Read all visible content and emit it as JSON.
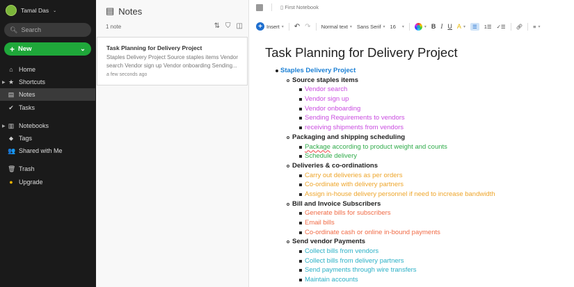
{
  "sidebar": {
    "user": "Tamal Das",
    "search_placeholder": "Search",
    "new_label": "New",
    "items": [
      {
        "label": "Home",
        "icon": "home-icon",
        "glyph": "⌂"
      },
      {
        "label": "Shortcuts",
        "icon": "star-icon",
        "glyph": "★"
      },
      {
        "label": "Notes",
        "icon": "notes-icon",
        "glyph": "▤"
      },
      {
        "label": "Tasks",
        "icon": "tasks-icon",
        "glyph": "✔"
      },
      {
        "label": "Notebooks",
        "icon": "notebook-icon",
        "glyph": "▥"
      },
      {
        "label": "Tags",
        "icon": "tag-icon",
        "glyph": "⬥"
      },
      {
        "label": "Shared with Me",
        "icon": "shared-icon",
        "glyph": "👥"
      },
      {
        "label": "Trash",
        "icon": "trash-icon",
        "glyph": "🗑"
      },
      {
        "label": "Upgrade",
        "icon": "upgrade-icon",
        "glyph": "●"
      }
    ]
  },
  "notelist": {
    "title": "Notes",
    "count": "1 note",
    "note": {
      "title": "Task Planning for Delivery Project",
      "snippet": "Staples Delivery Project Source staples items Vendor search Vendor sign up Vendor onboarding Sending...",
      "time": "a few seconds ago"
    }
  },
  "editor": {
    "notebook": "First Notebook",
    "toolbar": {
      "insert": "Insert",
      "style": "Normal text",
      "font": "Sans Serif",
      "size": "16"
    },
    "title": "Task Planning for Delivery Project",
    "colors": {
      "project": "#1a7fd4",
      "purple": "#c94be0",
      "green": "#2fab4a",
      "orange": "#eea52a",
      "red": "#f06a45",
      "teal": "#2bb0c6"
    },
    "outline": [
      {
        "level": 1,
        "text": "Staples Delivery Project",
        "color": "project"
      },
      {
        "level": 2,
        "text": "Source staples items"
      },
      {
        "level": 3,
        "text": "Vendor search",
        "color": "purple"
      },
      {
        "level": 3,
        "text": "Vendor sign up",
        "color": "purple"
      },
      {
        "level": 3,
        "text": "Vendor onboarding",
        "color": "purple"
      },
      {
        "level": 3,
        "text": "Sending Requirements to vendors",
        "color": "purple"
      },
      {
        "level": 3,
        "text": "receiving shipments from vendors",
        "color": "purple"
      },
      {
        "level": 2,
        "text": "Packaging and shipping scheduling"
      },
      {
        "level": 3,
        "text": "Package according to product weight and counts",
        "color": "green",
        "spell": "Package"
      },
      {
        "level": 3,
        "text": "Schedule delivery",
        "color": "green"
      },
      {
        "level": 2,
        "text": "Deliveries & co-ordinations"
      },
      {
        "level": 3,
        "text": "Carry out deliveries as per orders",
        "color": "orange"
      },
      {
        "level": 3,
        "text": "Co-ordinate with delivery partners",
        "color": "orange"
      },
      {
        "level": 3,
        "text": "Assign in-house delivery personnel if need to increase bandwidth",
        "color": "orange"
      },
      {
        "level": 2,
        "text": "Bill and Invoice Subscribers"
      },
      {
        "level": 3,
        "text": "Generate bills for subscribers",
        "color": "red"
      },
      {
        "level": 3,
        "text": "Email bills",
        "color": "red"
      },
      {
        "level": 3,
        "text": "Co-ordinate cash or online in-bound payments",
        "color": "red"
      },
      {
        "level": 2,
        "text": "Send vendor Payments"
      },
      {
        "level": 3,
        "text": "Collect bills from vendors",
        "color": "teal"
      },
      {
        "level": 3,
        "text": "Collect bills from delivery partners",
        "color": "teal"
      },
      {
        "level": 3,
        "text": "Send payments through wire transfers",
        "color": "teal"
      },
      {
        "level": 3,
        "text": "Maintain accounts",
        "color": "teal"
      }
    ]
  }
}
